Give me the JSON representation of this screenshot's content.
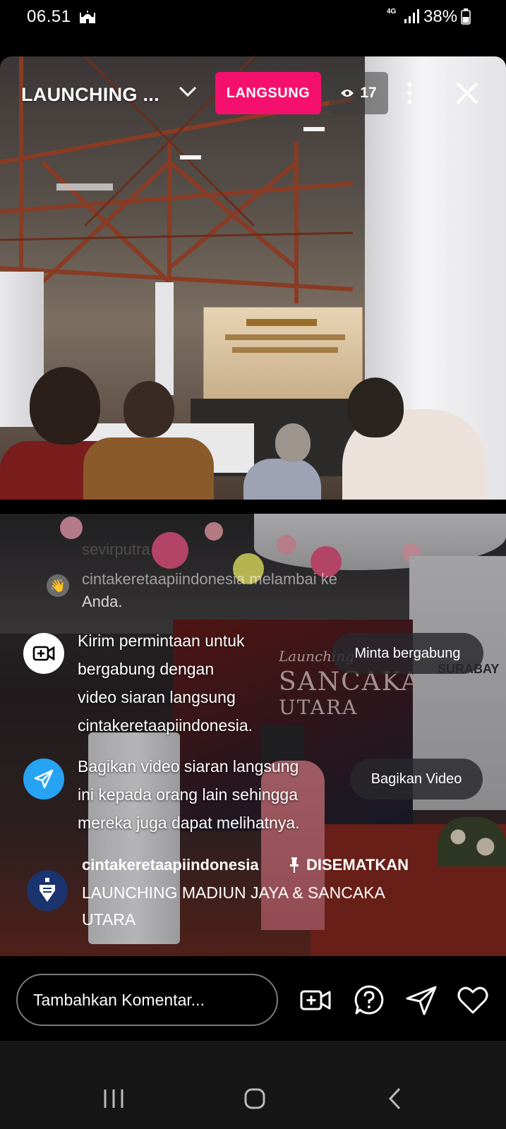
{
  "status_bar": {
    "time": "06.51",
    "network": "4G",
    "battery": "38%"
  },
  "live": {
    "title": "LAUNCHING ...",
    "badge": "LANGSUNG",
    "viewers": "17"
  },
  "video_scene": {
    "banner_line1": "Launching",
    "banner_line2": "SANCAKA",
    "banner_line3": "UTARA",
    "wall_sign": "SURABAY"
  },
  "comments": {
    "faded_user": "sevirputra",
    "wave_text": "cintakeretaapiindonesia melambai ke",
    "wave_text2": "Anda."
  },
  "join_prompt": {
    "lines": [
      "Kirim permintaan untuk",
      "bergabung dengan",
      "video siaran langsung",
      "cintakeretaapiindonesia."
    ],
    "button": "Minta bergabung"
  },
  "share_prompt": {
    "lines": [
      "Bagikan video siaran langsung",
      "ini kepada orang lain sehingga",
      "mereka juga dapat melihatnya."
    ],
    "button": "Bagikan Video"
  },
  "pinned": {
    "username": "cintakeretaapiindonesia",
    "tag": "DISEMATKAN",
    "text": "LAUNCHING MADIUN JAYA & SANCAKA UTARA"
  },
  "composer": {
    "placeholder": "Tambahkan Komentar..."
  },
  "colors": {
    "live_badge": "#f5106d",
    "share_icon_bg": "#27a3f4",
    "avatar_bg": "#1b3470"
  },
  "icons": [
    "mosque-icon",
    "signal-icon",
    "battery-icon",
    "chevron-down-icon",
    "eye-icon",
    "more-icon",
    "close-icon",
    "wave-icon",
    "video-join-icon",
    "send-icon",
    "pin-icon",
    "add-video-icon",
    "question-icon",
    "share-icon",
    "heart-icon",
    "recents-icon",
    "home-icon",
    "back-icon"
  ]
}
